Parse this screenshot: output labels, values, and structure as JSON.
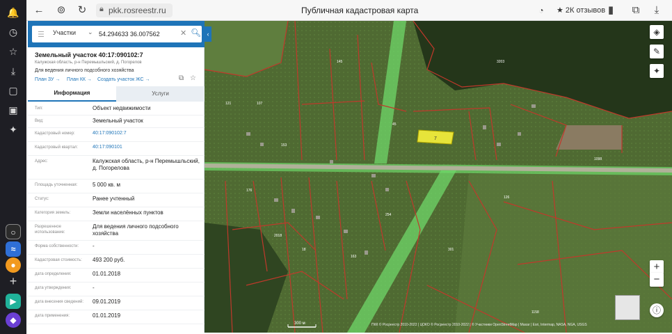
{
  "browser": {
    "url": "pkk.rosreestr.ru",
    "title": "Публичная кадастровая карта",
    "reviews": "2К отзывов"
  },
  "search": {
    "category": "Участки",
    "value": "54.294633 36.007562"
  },
  "object": {
    "title": "Земельный участок 40:17:090102:7",
    "address_short": "Калужская область, р-н Перемышльский, д. Погорелов",
    "use": "Для ведения личного подсобного хозяйства",
    "links": [
      "План ЗУ →",
      "План КК →",
      "Создать участок ЖС →"
    ]
  },
  "tabs": {
    "info": "Информация",
    "services": "Услуги"
  },
  "properties": [
    {
      "label": "Тип:",
      "value": "Объект недвижимости"
    },
    {
      "label": "Вид:",
      "value": "Земельный участок"
    },
    {
      "label": "Кадастровый номер:",
      "value": "40:17:090102:7"
    },
    {
      "label": "Кадастровый квартал:",
      "value": "40:17:090101"
    },
    {
      "label": "Адрес:",
      "value": "Калужская область, р-н Перемышльский, д. Погорелова"
    },
    {
      "label": "Площадь уточненная:",
      "value": "5 000 кв. м"
    },
    {
      "label": "Статус:",
      "value": "Ранее учтенный"
    },
    {
      "label": "Категория земель:",
      "value": "Земли населённых пунктов"
    },
    {
      "label": "Разрешенное использование:",
      "value": "Для ведения личного подсобного хозяйства"
    },
    {
      "label": "Форма собственности:",
      "value": "-"
    },
    {
      "label": "Кадастровая стоимость:",
      "value": "493 200 руб."
    },
    {
      "label": "дата определения:",
      "value": "01.01.2018"
    },
    {
      "label": "дата утверждения:",
      "value": "-"
    },
    {
      "label": "дата внесения сведений:",
      "value": "09.01.2019"
    },
    {
      "label": "дата применения:",
      "value": "01.01.2019"
    }
  ],
  "map": {
    "scale": "300 м",
    "attribution": "ПКК © Росреестр 2010-2022 | ЦОКО © Росреестр 2010-2022 | © Участники OpenStreetMap | Maxar | Esri, Intermap, NASA, NGA, USGS",
    "selected_parcel_label": "7",
    "colors": {
      "satellite": "#3f5a2a",
      "boundary": "#c0392b",
      "selected": "#e7e43a",
      "road_zone": "#6fd86a"
    }
  },
  "icons": [
    "back-icon",
    "reload-icon",
    "lock-icon",
    "bookmark-icon",
    "download-icon",
    "layers-icon",
    "ruler-icon",
    "locate-icon",
    "zoom-in-icon",
    "zoom-out-icon",
    "info-icon"
  ]
}
